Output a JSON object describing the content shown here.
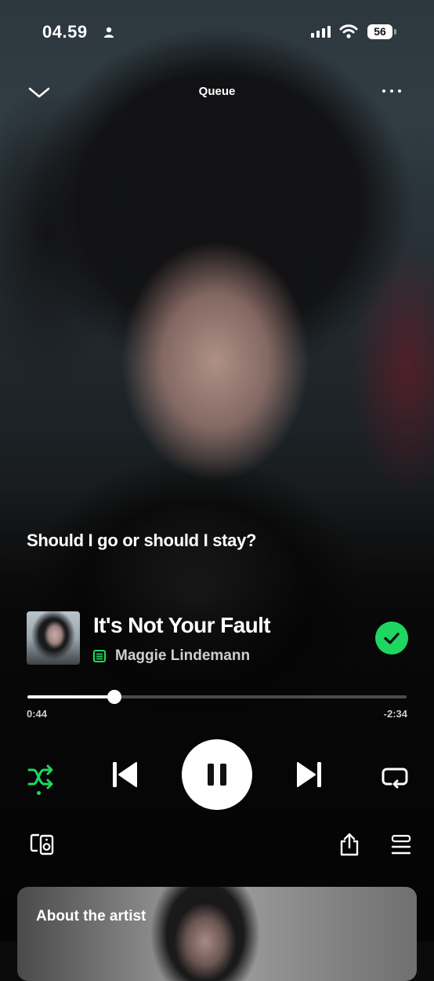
{
  "status_bar": {
    "time": "04.59",
    "battery": "56"
  },
  "header": {
    "title": "Queue"
  },
  "lyrics_snippet": "Should I go or should I stay?",
  "now_playing": {
    "title": "It's Not Your Fault",
    "artist": "Maggie Lindemann",
    "saved": true
  },
  "progress": {
    "elapsed": "0:44",
    "remaining": "-2:34",
    "fraction": 0.23
  },
  "controls": {
    "shuffle_active": true,
    "state": "playing"
  },
  "about_card": {
    "title": "About the artist"
  },
  "colors": {
    "accent": "#1ed760",
    "text": "#ffffff",
    "muted": "#cfcfcf"
  }
}
